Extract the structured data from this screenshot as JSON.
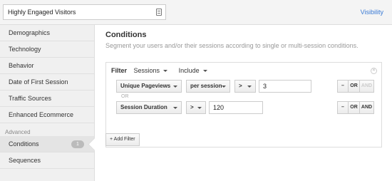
{
  "header": {
    "segment_name_value": "Highly Engaged Visitors",
    "visibility_label": "Visibility"
  },
  "sidebar": {
    "items": [
      {
        "label": "Demographics"
      },
      {
        "label": "Technology"
      },
      {
        "label": "Behavior"
      },
      {
        "label": "Date of First Session"
      },
      {
        "label": "Traffic Sources"
      },
      {
        "label": "Enhanced Ecommerce"
      }
    ],
    "advanced_label": "Advanced",
    "advanced_items": [
      {
        "label": "Conditions",
        "count": "1"
      },
      {
        "label": "Sequences"
      }
    ]
  },
  "main": {
    "title": "Conditions",
    "subtitle": "Segment your users and/or their sessions according to single or multi-session conditions.",
    "filter": {
      "label": "Filter",
      "scope_select": "Sessions",
      "mode_select": "Include",
      "remove_icon": "x-icon",
      "or_label": "OR",
      "rows": [
        {
          "dimension": "Unique Pageviews",
          "per": "per session",
          "operator": ">",
          "value": "3",
          "minus_label": "–",
          "or_label": "OR",
          "and_label": "AND"
        },
        {
          "dimension": "Session Duration",
          "operator": ">",
          "value": "120",
          "minus_label": "–",
          "or_label": "OR",
          "and_label": "AND"
        }
      ]
    },
    "add_filter_label": "+ Add Filter"
  }
}
